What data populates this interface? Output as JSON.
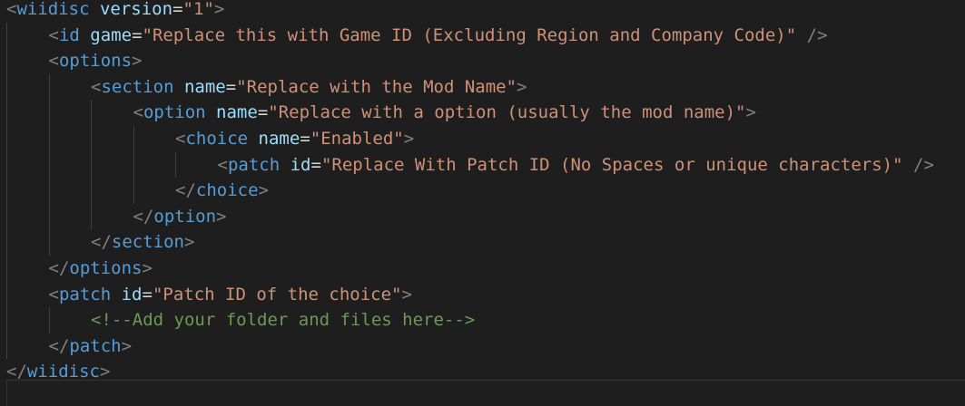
{
  "editor": {
    "lines": [
      {
        "indent": 0,
        "tokens": [
          {
            "k": "b",
            "v": "<"
          },
          {
            "k": "t",
            "v": "wiidisc"
          },
          {
            "k": "e",
            "v": " "
          },
          {
            "k": "a",
            "v": "version"
          },
          {
            "k": "e",
            "v": "="
          },
          {
            "k": "s",
            "v": "\"1\""
          },
          {
            "k": "b",
            "v": ">"
          }
        ]
      },
      {
        "indent": 1,
        "tokens": [
          {
            "k": "b",
            "v": "<"
          },
          {
            "k": "t",
            "v": "id"
          },
          {
            "k": "e",
            "v": " "
          },
          {
            "k": "a",
            "v": "game"
          },
          {
            "k": "e",
            "v": "="
          },
          {
            "k": "s",
            "v": "\"Replace this with Game ID (Excluding Region and Company Code)\""
          },
          {
            "k": "e",
            "v": " "
          },
          {
            "k": "b",
            "v": "/>"
          }
        ]
      },
      {
        "indent": 1,
        "tokens": [
          {
            "k": "b",
            "v": "<"
          },
          {
            "k": "t",
            "v": "options"
          },
          {
            "k": "b",
            "v": ">"
          }
        ]
      },
      {
        "indent": 2,
        "tokens": [
          {
            "k": "b",
            "v": "<"
          },
          {
            "k": "t",
            "v": "section"
          },
          {
            "k": "e",
            "v": " "
          },
          {
            "k": "a",
            "v": "name"
          },
          {
            "k": "e",
            "v": "="
          },
          {
            "k": "s",
            "v": "\"Replace with the Mod Name\""
          },
          {
            "k": "b",
            "v": ">"
          }
        ]
      },
      {
        "indent": 3,
        "tokens": [
          {
            "k": "b",
            "v": "<"
          },
          {
            "k": "t",
            "v": "option"
          },
          {
            "k": "e",
            "v": " "
          },
          {
            "k": "a",
            "v": "name"
          },
          {
            "k": "e",
            "v": "="
          },
          {
            "k": "s",
            "v": "\"Replace with a option (usually the mod name)\""
          },
          {
            "k": "b",
            "v": ">"
          }
        ]
      },
      {
        "indent": 4,
        "tokens": [
          {
            "k": "b",
            "v": "<"
          },
          {
            "k": "t",
            "v": "choice"
          },
          {
            "k": "e",
            "v": " "
          },
          {
            "k": "a",
            "v": "name"
          },
          {
            "k": "e",
            "v": "="
          },
          {
            "k": "s",
            "v": "\"Enabled\""
          },
          {
            "k": "b",
            "v": ">"
          }
        ]
      },
      {
        "indent": 5,
        "tokens": [
          {
            "k": "b",
            "v": "<"
          },
          {
            "k": "t",
            "v": "patch"
          },
          {
            "k": "e",
            "v": " "
          },
          {
            "k": "a",
            "v": "id"
          },
          {
            "k": "e",
            "v": "="
          },
          {
            "k": "s",
            "v": "\"Replace With Patch ID (No Spaces or unique characters)\""
          },
          {
            "k": "e",
            "v": " "
          },
          {
            "k": "b",
            "v": "/>"
          }
        ]
      },
      {
        "indent": 4,
        "tokens": [
          {
            "k": "b",
            "v": "</"
          },
          {
            "k": "t",
            "v": "choice"
          },
          {
            "k": "b",
            "v": ">"
          }
        ]
      },
      {
        "indent": 3,
        "tokens": [
          {
            "k": "b",
            "v": "</"
          },
          {
            "k": "t",
            "v": "option"
          },
          {
            "k": "b",
            "v": ">"
          }
        ]
      },
      {
        "indent": 2,
        "tokens": [
          {
            "k": "b",
            "v": "</"
          },
          {
            "k": "t",
            "v": "section"
          },
          {
            "k": "b",
            "v": ">"
          }
        ]
      },
      {
        "indent": 1,
        "tokens": [
          {
            "k": "b",
            "v": "</"
          },
          {
            "k": "t",
            "v": "options"
          },
          {
            "k": "b",
            "v": ">"
          }
        ]
      },
      {
        "indent": 1,
        "tokens": [
          {
            "k": "b",
            "v": "<"
          },
          {
            "k": "t",
            "v": "patch"
          },
          {
            "k": "e",
            "v": " "
          },
          {
            "k": "a",
            "v": "id"
          },
          {
            "k": "e",
            "v": "="
          },
          {
            "k": "s",
            "v": "\"Patch ID of the choice\""
          },
          {
            "k": "b",
            "v": ">"
          }
        ]
      },
      {
        "indent": 2,
        "tokens": [
          {
            "k": "c",
            "v": "<!--Add your folder and files here-->"
          }
        ]
      },
      {
        "indent": 1,
        "tokens": [
          {
            "k": "b",
            "v": "</"
          },
          {
            "k": "t",
            "v": "patch"
          },
          {
            "k": "b",
            "v": ">"
          }
        ]
      },
      {
        "indent": 0,
        "tokens": [
          {
            "k": "b",
            "v": "</"
          },
          {
            "k": "t",
            "v": "wiidisc"
          },
          {
            "k": "b",
            "v": ">"
          }
        ]
      }
    ]
  },
  "colors": {
    "background": "#1e1e1e",
    "bracket": "#808080",
    "tag": "#569cd6",
    "attribute": "#9cdcfe",
    "string": "#ce9178",
    "comment": "#6a9955",
    "indent_guide": "#404040"
  }
}
